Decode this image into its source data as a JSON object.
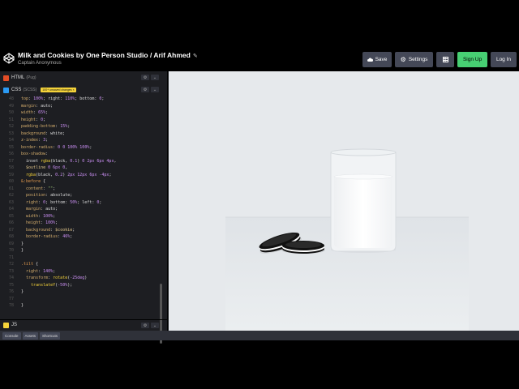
{
  "header": {
    "title": "Milk and Cookies by One Person Studio / Arif Ahmed",
    "author": "Captain Anonymous",
    "buttons": {
      "save": "Save",
      "settings": "Settings",
      "signup": "Sign Up",
      "login": "Log In"
    }
  },
  "panels": {
    "html": {
      "label": "HTML",
      "sub": "(Pug)"
    },
    "css": {
      "label": "CSS",
      "sub": "(SCSS)",
      "badge": "100+ unsaved changes ×"
    },
    "js": {
      "label": "JS"
    }
  },
  "code_lines": [
    {
      "n": "48",
      "text": "top: 100%; right: 110%; bottom: 0;"
    },
    {
      "n": "49",
      "text": "margin: auto;"
    },
    {
      "n": "50",
      "text": "width: 65%;"
    },
    {
      "n": "51",
      "text": "height: 0;"
    },
    {
      "n": "52",
      "text": "padding-bottom: 15%;"
    },
    {
      "n": "53",
      "text": "background: white;"
    },
    {
      "n": "54",
      "text": "z-index: 3;"
    },
    {
      "n": "55",
      "text": "border-radius: 0 0 100% 100%;"
    },
    {
      "n": "56",
      "text": "box-shadow:"
    },
    {
      "n": "57",
      "text": "  inset rgba(black, 0.1) 0 2px 6px 4px,"
    },
    {
      "n": "58",
      "text": "  $outline 0 6px 0,"
    },
    {
      "n": "59",
      "text": "  rgba(black, 0.2) 2px 12px 6px -4px;"
    },
    {
      "n": "60",
      "text": "&:before {"
    },
    {
      "n": "61",
      "text": "  content: \"\";"
    },
    {
      "n": "62",
      "text": "  position: absolute;"
    },
    {
      "n": "63",
      "text": "  right: 0; bottom: 50%; left: 0;"
    },
    {
      "n": "64",
      "text": "  margin: auto;"
    },
    {
      "n": "65",
      "text": "  width: 100%;"
    },
    {
      "n": "66",
      "text": "  height: 100%;"
    },
    {
      "n": "67",
      "text": "  background: $cookie;"
    },
    {
      "n": "68",
      "text": "  border-radius: 46%;"
    },
    {
      "n": "69",
      "text": "}"
    },
    {
      "n": "70",
      "text": "}"
    },
    {
      "n": "71",
      "text": ""
    },
    {
      "n": "72",
      "text": ".tilt {"
    },
    {
      "n": "73",
      "text": "  right: 140%;"
    },
    {
      "n": "74",
      "text": "  transform: rotate(-25deg)"
    },
    {
      "n": "75",
      "text": "    translateY(-50%);"
    },
    {
      "n": "76",
      "text": "}"
    },
    {
      "n": "77",
      "text": ""
    },
    {
      "n": "78",
      "text": "}"
    }
  ],
  "footer": {
    "console": "Console",
    "assets": "Assets",
    "shortcuts": "Shortcuts"
  },
  "colors": {
    "accent_green": "#47cf73",
    "html_icon": "#e44d26",
    "css_icon": "#2b9af3",
    "js_icon": "#f5d33a",
    "preview_bg": "#e6e9ec"
  }
}
